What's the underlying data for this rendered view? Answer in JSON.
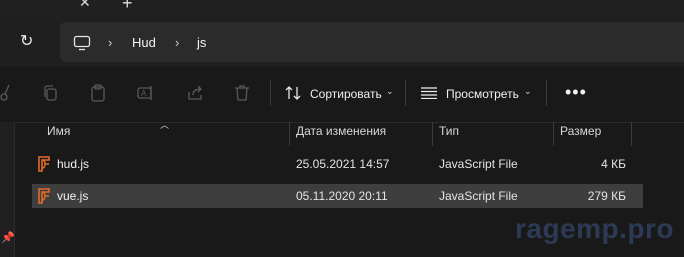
{
  "tabs": {
    "close_glyph": "✕",
    "new_glyph": "+"
  },
  "address": {
    "refresh_glyph": "↻",
    "crumbs": [
      "Hud",
      "js"
    ]
  },
  "toolbar": {
    "sort_label": "Сортировать",
    "view_label": "Просмотреть",
    "more_glyph": "•••"
  },
  "columns": {
    "name": "Имя",
    "date": "Дата изменения",
    "type": "Тип",
    "size": "Размер"
  },
  "files": [
    {
      "name": "hud.js",
      "date": "25.05.2021 14:57",
      "type": "JavaScript File",
      "size": "4 КБ"
    },
    {
      "name": "vue.js",
      "date": "05.11.2020 20:11",
      "type": "JavaScript File",
      "size": "279 КБ"
    }
  ],
  "watermark": "ragemp.pro",
  "colors": {
    "background": "#191919",
    "selected_row": "#3e3e3e",
    "js_icon": "#e46a2a"
  }
}
